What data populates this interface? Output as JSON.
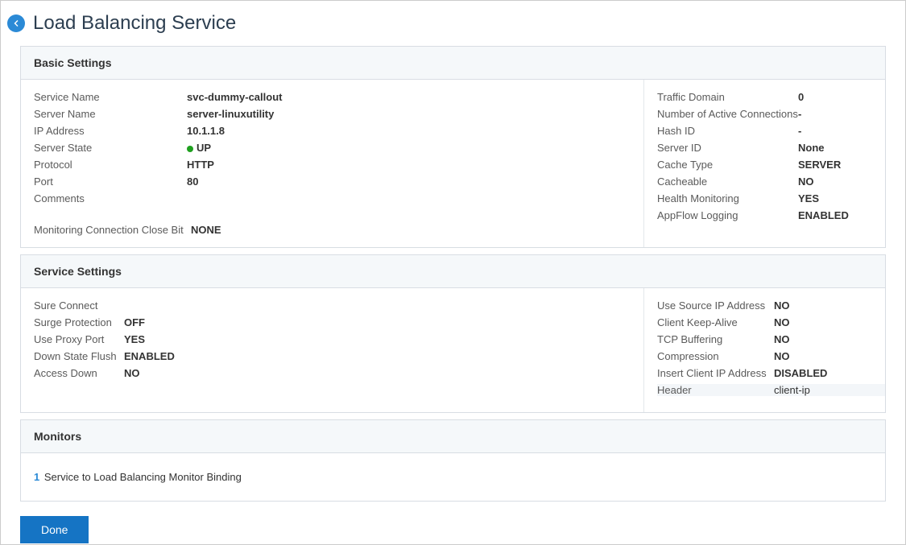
{
  "page_title": "Load Balancing Service",
  "basic_settings": {
    "header": "Basic Settings",
    "left": {
      "service_name": {
        "label": "Service Name",
        "value": "svc-dummy-callout"
      },
      "server_name": {
        "label": "Server Name",
        "value": "server-linuxutility"
      },
      "ip_address": {
        "label": "IP Address",
        "value": "10.1.1.8"
      },
      "server_state": {
        "label": "Server State",
        "value": "UP"
      },
      "protocol": {
        "label": "Protocol",
        "value": "HTTP"
      },
      "port": {
        "label": "Port",
        "value": "80"
      },
      "comments": {
        "label": "Comments",
        "value": ""
      },
      "mon_close_bit": {
        "label": "Monitoring Connection Close Bit",
        "value": "NONE"
      }
    },
    "right": {
      "traffic_domain": {
        "label": "Traffic Domain",
        "value": "0"
      },
      "active_connections": {
        "label": "Number of Active Connections",
        "value": "-"
      },
      "hash_id": {
        "label": "Hash ID",
        "value": "-"
      },
      "server_id": {
        "label": "Server ID",
        "value": "None"
      },
      "cache_type": {
        "label": "Cache Type",
        "value": "SERVER"
      },
      "cacheable": {
        "label": "Cacheable",
        "value": "NO"
      },
      "health_monitoring": {
        "label": "Health Monitoring",
        "value": "YES"
      },
      "appflow_logging": {
        "label": "AppFlow Logging",
        "value": "ENABLED"
      }
    }
  },
  "service_settings": {
    "header": "Service Settings",
    "left": {
      "sure_connect": {
        "label": "Sure Connect",
        "value": ""
      },
      "surge_protection": {
        "label": "Surge Protection",
        "value": "OFF"
      },
      "use_proxy_port": {
        "label": "Use Proxy Port",
        "value": "YES"
      },
      "down_state_flush": {
        "label": "Down State Flush",
        "value": "ENABLED"
      },
      "access_down": {
        "label": "Access Down",
        "value": "NO"
      }
    },
    "right": {
      "use_source_ip": {
        "label": "Use Source IP Address",
        "value": "NO"
      },
      "client_keep_alive": {
        "label": "Client Keep-Alive",
        "value": "NO"
      },
      "tcp_buffering": {
        "label": "TCP Buffering",
        "value": "NO"
      },
      "compression": {
        "label": "Compression",
        "value": "NO"
      },
      "insert_client_ip": {
        "label": "Insert Client IP Address",
        "value": "DISABLED"
      },
      "header": {
        "label": "Header",
        "value": "client-ip"
      }
    }
  },
  "monitors": {
    "header": "Monitors",
    "count": "1",
    "text": "Service to Load Balancing Monitor Binding"
  },
  "done_button": "Done"
}
